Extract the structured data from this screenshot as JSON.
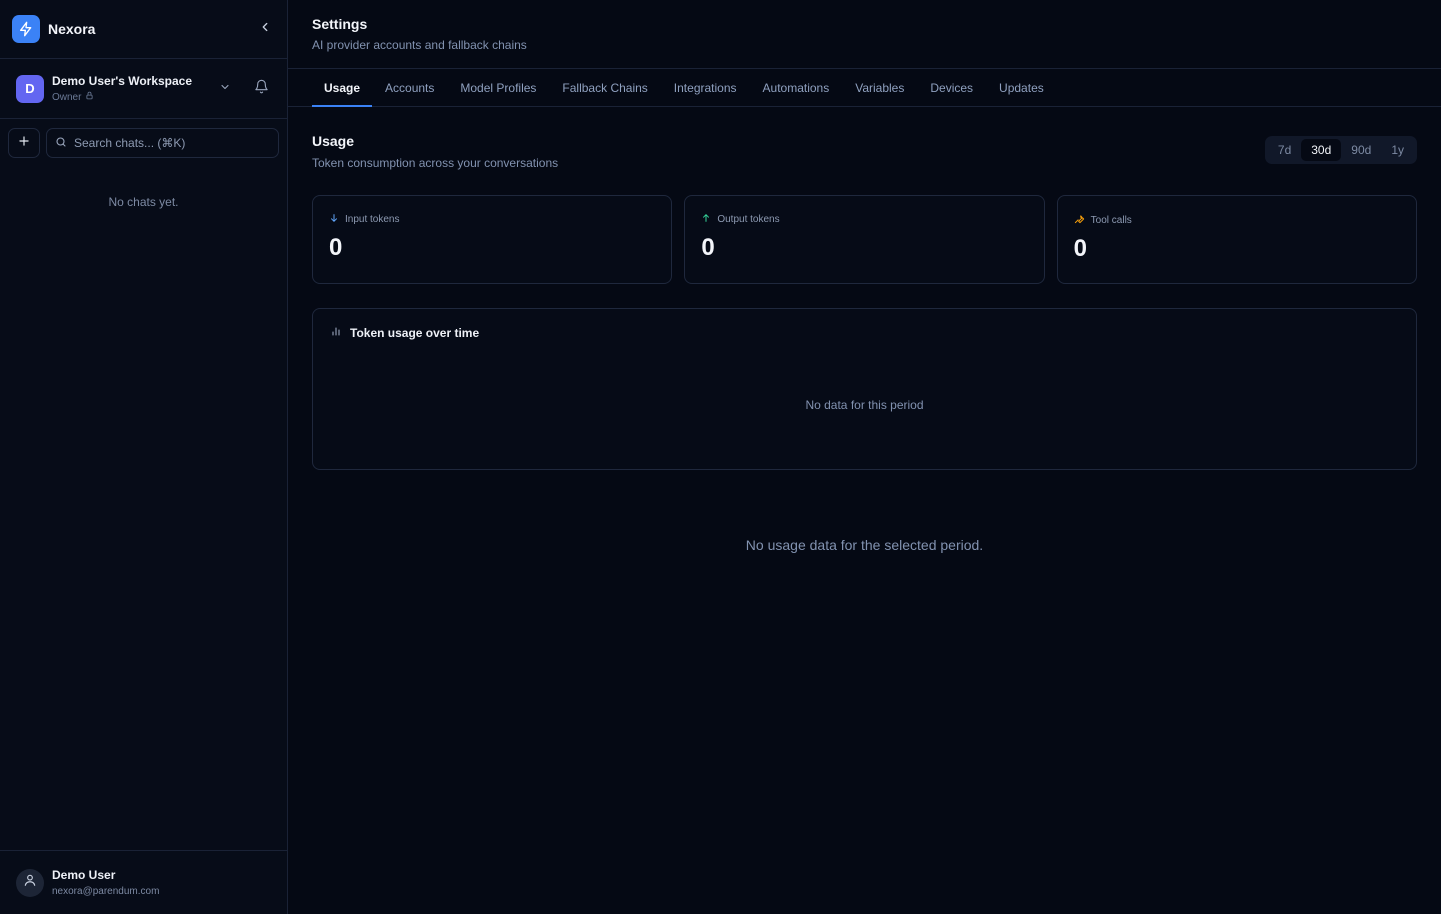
{
  "app": {
    "name": "Nexora",
    "accent": "#3b82f6",
    "icons": {
      "logo": "lightning-icon",
      "collapse": "chevron-left-icon"
    }
  },
  "workspace": {
    "initial": "D",
    "name": "Demo User's Workspace",
    "role": "Owner",
    "color": "#6366f1"
  },
  "sidebar": {
    "search_placeholder": "Search chats... (⌘K)",
    "empty_text": "No chats yet."
  },
  "user": {
    "name": "Demo User",
    "email": "nexora@parendum.com"
  },
  "header": {
    "title": "Settings",
    "subtitle": "AI provider accounts and fallback chains"
  },
  "tabs": [
    {
      "label": "Usage",
      "active": true
    },
    {
      "label": "Accounts"
    },
    {
      "label": "Model Profiles"
    },
    {
      "label": "Fallback Chains"
    },
    {
      "label": "Integrations"
    },
    {
      "label": "Automations"
    },
    {
      "label": "Variables"
    },
    {
      "label": "Devices"
    },
    {
      "label": "Updates"
    }
  ],
  "usage": {
    "title": "Usage",
    "subtitle": "Token consumption across your conversations",
    "ranges": [
      "7d",
      "30d",
      "90d",
      "1y"
    ],
    "selected_range": "30d",
    "stats": [
      {
        "label": "Input tokens",
        "value": "0",
        "icon": "arrow-down-icon",
        "icon_color": "#60a5fa"
      },
      {
        "label": "Output tokens",
        "value": "0",
        "icon": "arrow-up-icon",
        "icon_color": "#34d399"
      },
      {
        "label": "Tool calls",
        "value": "0",
        "icon": "wrench-icon",
        "icon_color": "#f59e0b"
      }
    ],
    "chart": {
      "title": "Token usage over time",
      "empty_text": "No data for this period"
    },
    "empty_text": "No usage data for the selected period."
  }
}
